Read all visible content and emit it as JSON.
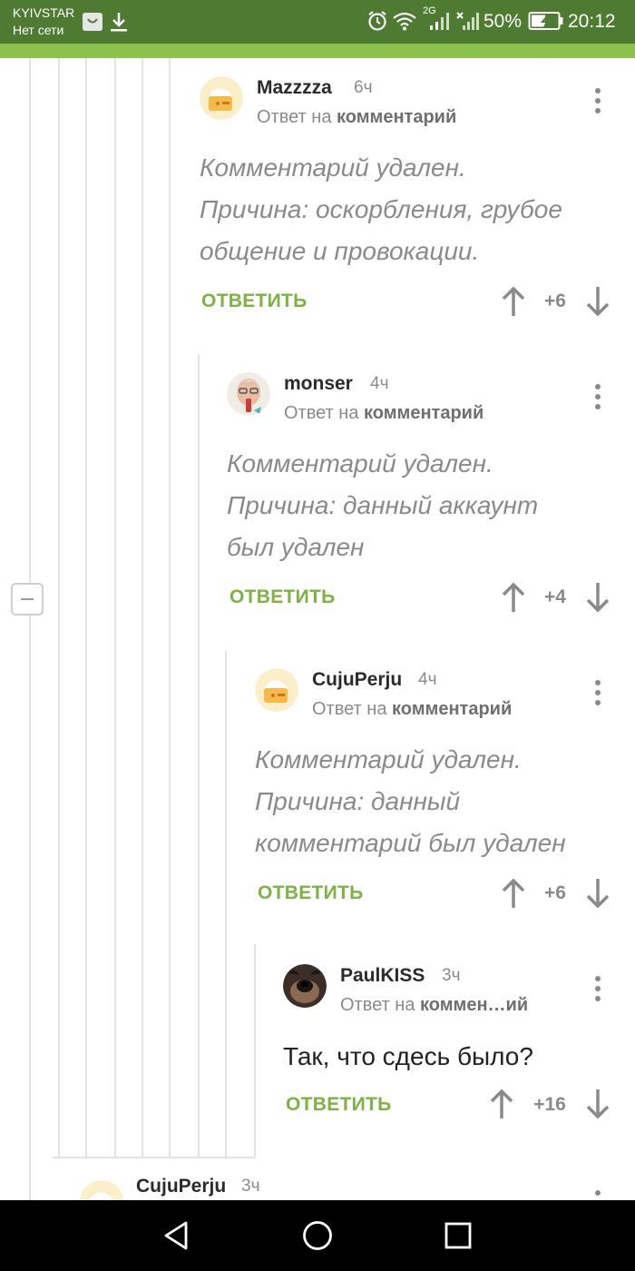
{
  "status_bar": {
    "carrier": "KYIVSTAR",
    "network_status": "Нет сети",
    "network_type": "2G",
    "battery": "50%",
    "time": "20:12"
  },
  "comments": [
    {
      "username": "Mazzzza",
      "time": "6ч",
      "reply_prefix": "Ответ на",
      "reply_target": "комментарий",
      "text_lines": [
        "Комментарий удален.",
        "Причина: оскорбления, грубое",
        "общение и провокации."
      ],
      "reply_label": "ОТВЕТИТЬ",
      "score": "+6",
      "avatar": "default-cake-avatar"
    },
    {
      "username": "monser",
      "time": "4ч",
      "reply_prefix": "Ответ на",
      "reply_target": "комментарий",
      "text_lines": [
        "Комментарий удален.",
        "Причина: данный аккаунт",
        "был удален"
      ],
      "reply_label": "ОТВЕТИТЬ",
      "score": "+4",
      "avatar": "old-man-photo-avatar"
    },
    {
      "username": "CujuPerju",
      "time": "4ч",
      "reply_prefix": "Ответ на",
      "reply_target": "комментарий",
      "text_lines": [
        "Комментарий удален.",
        "Причина: данный",
        "комментарий был удален"
      ],
      "reply_label": "ОТВЕТИТЬ",
      "score": "+6",
      "avatar": "default-cake-avatar"
    },
    {
      "username": "PaulKISS",
      "time": "3ч",
      "reply_prefix": "Ответ на",
      "reply_target": "коммен…ий",
      "text": "Так, что сдесь было?",
      "reply_label": "ОТВЕТИТЬ",
      "score": "+16",
      "avatar": "dog-photo-avatar"
    },
    {
      "username": "CujuPerju",
      "time": "3ч",
      "avatar": "default-cake-avatar"
    }
  ],
  "nav": {
    "back": "back-icon",
    "home": "home-icon",
    "recents": "recents-icon"
  },
  "colors": {
    "accent": "#7cb342",
    "status_bar": "#4f7a32",
    "header_strip": "#8bc34a"
  }
}
